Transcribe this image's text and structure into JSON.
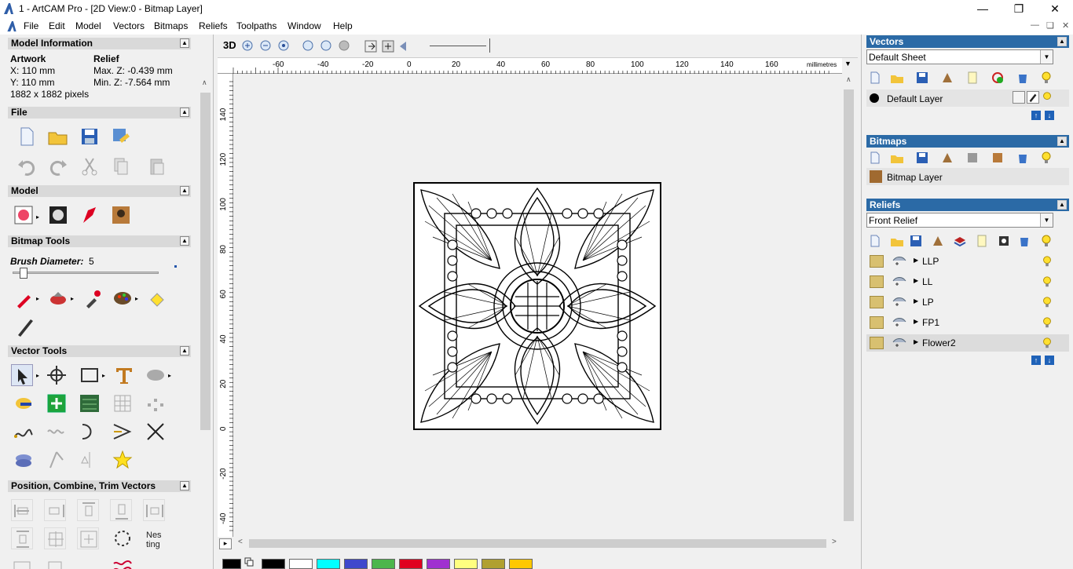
{
  "window": {
    "title": "1 - ArtCAM Pro - [2D View:0 - Bitmap Layer]",
    "minimize": "—",
    "maximize": "❐",
    "close": "✕"
  },
  "menu": {
    "items": [
      "File",
      "Edit",
      "Model",
      "Vectors",
      "Bitmaps",
      "Reliefs",
      "Toolpaths",
      "Window",
      "Help"
    ]
  },
  "model_info": {
    "header": "Model Information",
    "artwork_label": "Artwork",
    "relief_label": "Relief",
    "x": "X: 110 mm",
    "y": "Y: 110 mm",
    "max_z": "Max. Z: -0.439 mm",
    "min_z": "Min. Z: -7.564 mm",
    "pixels": "1882 x 1882 pixels"
  },
  "sections": {
    "file": "File",
    "model": "Model",
    "bitmap_tools": "Bitmap Tools",
    "vector_tools": "Vector Tools",
    "position": "Position, Combine, Trim Vectors"
  },
  "bitmap_tools": {
    "brush_label": "Brush Diameter:",
    "brush_value": "5",
    "brush_level": 0.05
  },
  "view": {
    "mode_label": "3D",
    "ruler_units": "millimetres",
    "top_ticks": [
      "-60",
      "-40",
      "-20",
      "0",
      "20",
      "40",
      "60",
      "80",
      "100",
      "120",
      "140",
      "160"
    ],
    "left_ticks": [
      "140",
      "120",
      "100",
      "80",
      "60",
      "40",
      "20",
      "0",
      "-20",
      "-40"
    ]
  },
  "palette": {
    "colors": [
      "#000000",
      "#ffffff",
      "#00ffff",
      "#3f48cc",
      "#4cb64c",
      "#e00020",
      "#a030d0",
      "#ffff80",
      "#b0a030",
      "#ffc800"
    ]
  },
  "vectors_panel": {
    "header": "Vectors",
    "sheet": "Default Sheet",
    "layer": "Default Layer"
  },
  "bitmaps_panel": {
    "header": "Bitmaps",
    "layer": "Bitmap Layer"
  },
  "reliefs_panel": {
    "header": "Reliefs",
    "relief": "Front Relief",
    "layers": [
      "LLP",
      "LL",
      "LP",
      "FP1",
      "Flower2"
    ]
  },
  "icons": {
    "collapse": "▲",
    "dropdown": "▼",
    "up": "↑",
    "down": "↓"
  }
}
